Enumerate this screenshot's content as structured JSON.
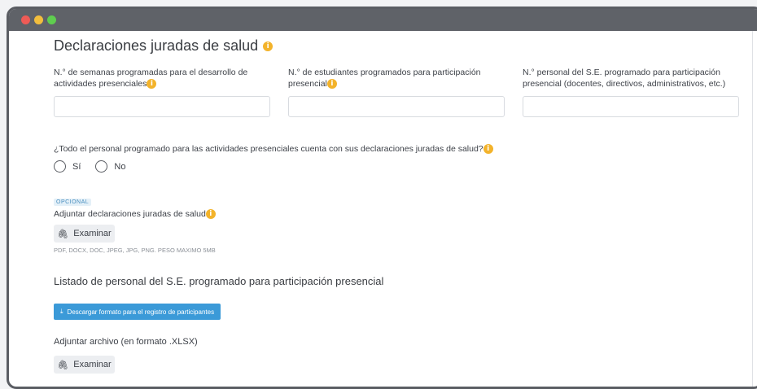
{
  "title": "Declaraciones juradas de salud",
  "fields": [
    {
      "label_line1": "N.° de semanas programadas para el desarrollo de",
      "label_line2": "actividades presenciales"
    },
    {
      "label_line1": "N.° de estudiantes programados para participación",
      "label_line2": "presencial"
    },
    {
      "label_line1": "N.° personal del S.E. programado para participación",
      "label_line2": "presencial (docentes, directivos, administrativos, etc.)"
    }
  ],
  "question": "¿Todo el personal programado para las actividades presenciales cuenta con sus declaraciones juradas de salud?",
  "radio_options": [
    "Sí",
    "No"
  ],
  "optional_badge": "OPCIONAL",
  "attach_label": "Adjuntar declaraciones juradas de salud",
  "browse_label": "Examinar",
  "formats_note": "PDF, DOCX, DOC, JPEG, JPG, PNG. PESO MAXIMO 5MB",
  "section_title": "Listado de personal del S.E. programado para participación presencial",
  "download_button": "Descargar formato para el registro de participantes",
  "attach_file_label": "Adjuntar archivo (en formato .XLSX)",
  "browse_label_2": "Examinar",
  "colors": {
    "accent_blue": "#3b9ad8",
    "info_orange": "#f3b32b"
  }
}
